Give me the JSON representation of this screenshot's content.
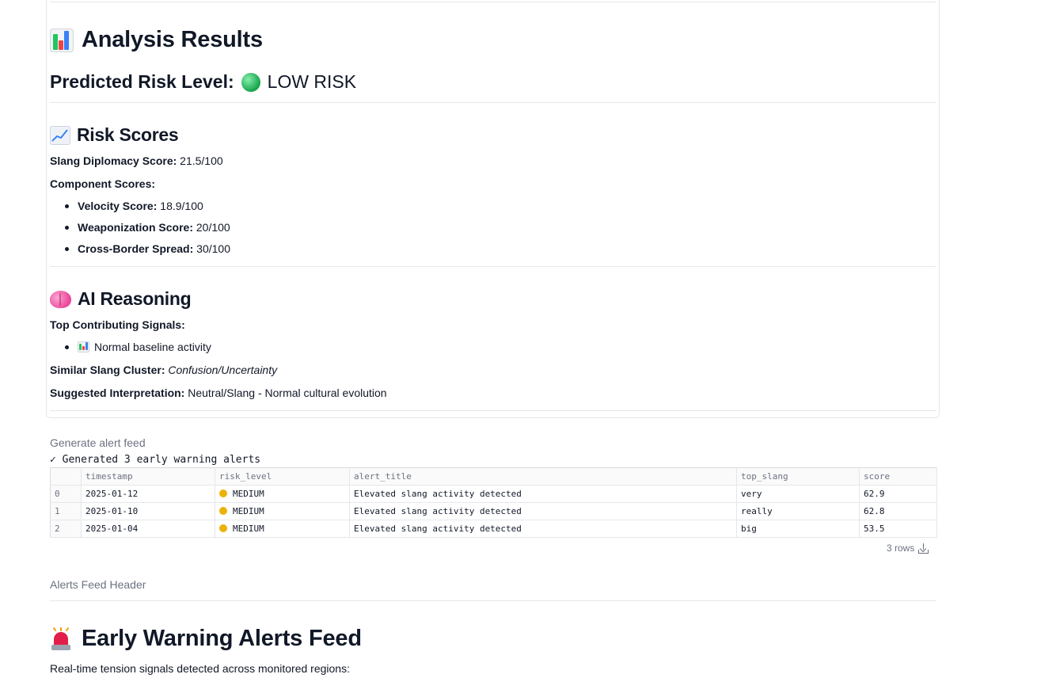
{
  "analysis": {
    "title": "Analysis Results",
    "predicted_label": "Predicted Risk Level:",
    "predicted_value": "LOW RISK",
    "risk_indicator_color": "#22c55e"
  },
  "risk_scores": {
    "title": "Risk Scores",
    "slang_label": "Slang Diplomacy Score:",
    "slang_value": "21.5/100",
    "components_label": "Component Scores:",
    "components": [
      {
        "label": "Velocity Score:",
        "value": "18.9/100"
      },
      {
        "label": "Weaponization Score:",
        "value": "20/100"
      },
      {
        "label": "Cross-Border Spread:",
        "value": "30/100"
      }
    ]
  },
  "reasoning": {
    "title": "AI Reasoning",
    "signals_label": "Top Contributing Signals:",
    "signals": [
      "Normal baseline activity"
    ],
    "cluster_label": "Similar Slang Cluster:",
    "cluster_value": "Confusion/Uncertainty",
    "interp_label": "Suggested Interpretation:",
    "interp_value": "Neutral/Slang - Normal cultural evolution"
  },
  "alert_feed_step": {
    "label": "Generate alert feed",
    "message": "✓ Generated 3 early warning alerts"
  },
  "table": {
    "columns": [
      "",
      "timestamp",
      "risk_level",
      "alert_title",
      "top_slang",
      "score"
    ],
    "rows": [
      {
        "index": "0",
        "timestamp": "2025-01-12",
        "risk_level": "MEDIUM",
        "alert_title": "Elevated slang activity detected",
        "top_slang": "very",
        "score": "62.9"
      },
      {
        "index": "1",
        "timestamp": "2025-01-10",
        "risk_level": "MEDIUM",
        "alert_title": "Elevated slang activity detected",
        "top_slang": "really",
        "score": "62.8"
      },
      {
        "index": "2",
        "timestamp": "2025-01-04",
        "risk_level": "MEDIUM",
        "alert_title": "Elevated slang activity detected",
        "top_slang": "big",
        "score": "53.5"
      }
    ],
    "row_count": "3 rows",
    "medium_color": "#eab308"
  },
  "alerts_header_step": {
    "label": "Alerts Feed Header"
  },
  "alerts_feed": {
    "title": "Early Warning Alerts Feed",
    "subtitle": "Real-time tension signals detected across monitored regions:"
  },
  "icons": {
    "analysis": "bar-chart-icon",
    "risk_scores": "trend-chart-icon",
    "reasoning": "brain-icon",
    "signal": "bar-chart-icon",
    "alerts": "siren-icon",
    "risk_indicator": "green-circle-icon",
    "download": "download-icon"
  }
}
